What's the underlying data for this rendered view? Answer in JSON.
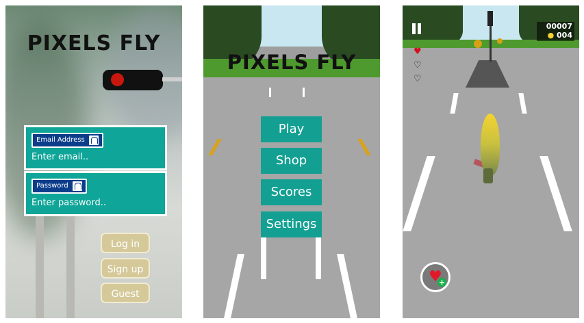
{
  "login_screen": {
    "title": "PIXELS FLY",
    "email": {
      "tag": "Email Address",
      "placeholder": "Enter email.."
    },
    "password": {
      "tag": "Password",
      "placeholder": "Enter password.."
    },
    "buttons": {
      "login": "Log in",
      "signup": "Sign up",
      "guest": "Guest"
    }
  },
  "menu_screen": {
    "title": "PIXELS FLY",
    "items": [
      "Play",
      "Shop",
      "Scores",
      "Settings"
    ]
  },
  "game_screen": {
    "score": "00007",
    "coins": "004",
    "lives": {
      "full": 1,
      "total": 3
    }
  },
  "colors": {
    "teal": "#13a093",
    "sign_tag": "#0c3d8a",
    "pill": "#d5c99a",
    "heart": "#d0121f"
  }
}
